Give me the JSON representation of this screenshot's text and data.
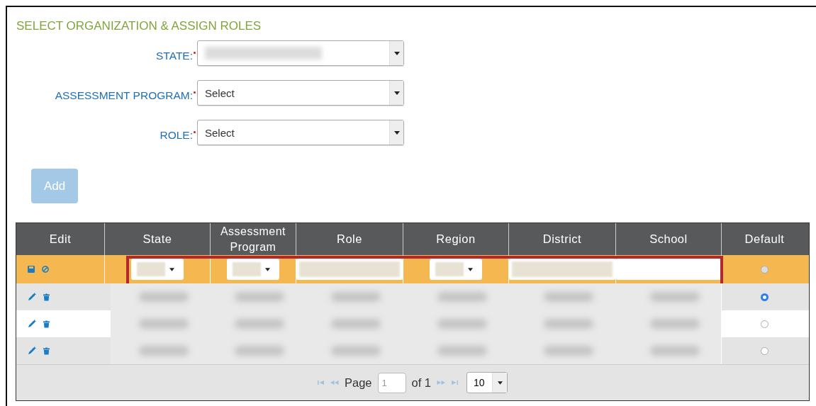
{
  "title": "SELECT ORGANIZATION & ASSIGN ROLES",
  "fields": [
    {
      "label": "STATE:",
      "required": true,
      "redacted": true
    },
    {
      "label": "ASSESSMENT PROGRAM:",
      "required": true,
      "value": "Select"
    },
    {
      "label": "ROLE:",
      "required": true,
      "value": "Select"
    }
  ],
  "add_button": {
    "label": "Add",
    "disabled": true
  },
  "table": {
    "columns": [
      "Edit",
      "State",
      "Assessment Program",
      "Role",
      "Region",
      "District",
      "School",
      "Default"
    ],
    "edit_row": {
      "cells": [
        {
          "kind": "select"
        },
        {
          "kind": "select"
        },
        {
          "kind": "text"
        },
        {
          "kind": "select"
        },
        {
          "kind": "text"
        },
        {
          "kind": "empty"
        }
      ],
      "default": false
    },
    "rows": [
      {
        "default": true
      },
      {
        "default": false
      },
      {
        "default": false
      }
    ]
  },
  "pager": {
    "page_label": "Page",
    "page": "1",
    "of": "of 1",
    "page_size": "10"
  }
}
